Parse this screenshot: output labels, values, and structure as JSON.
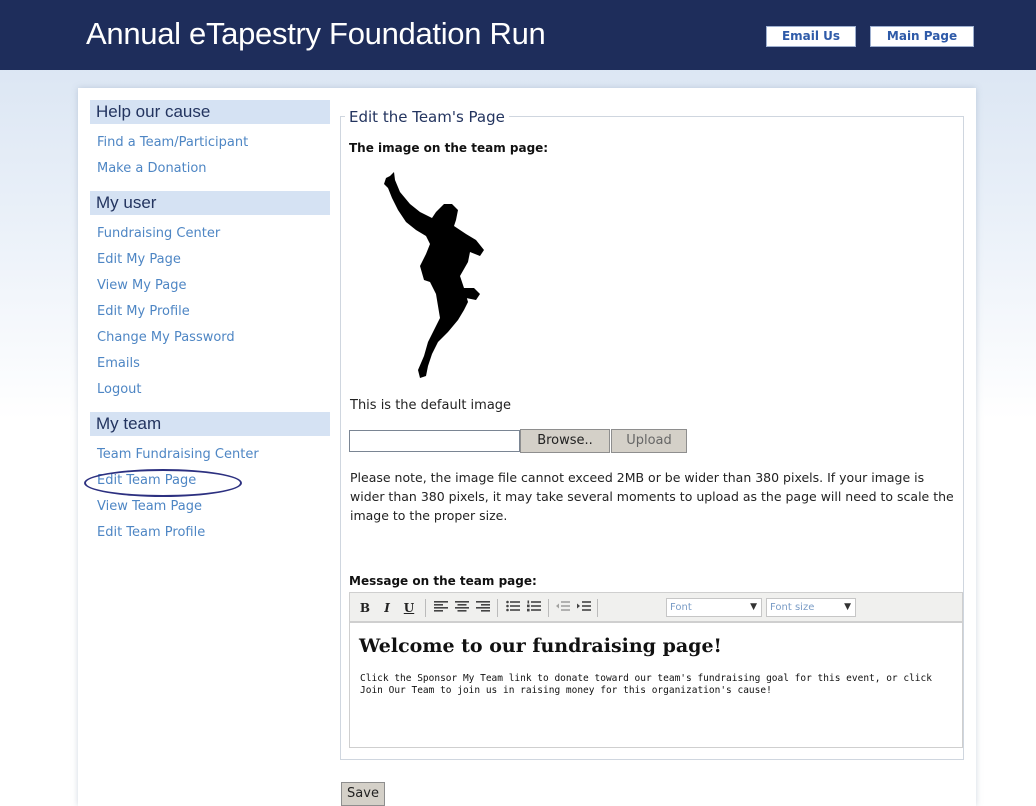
{
  "header": {
    "title": "Annual eTapestry Foundation Run",
    "email_us": "Email Us",
    "main_page": "Main Page"
  },
  "sidebar": {
    "sections": [
      {
        "heading": "Help our cause",
        "items": [
          "Find a Team/Participant",
          "Make a Donation"
        ]
      },
      {
        "heading": "My user",
        "items": [
          "Fundraising Center",
          "Edit My Page",
          "View My Page",
          "Edit My Profile",
          "Change My Password",
          "Emails",
          "Logout"
        ]
      },
      {
        "heading": "My team",
        "items": [
          "Team Fundraising Center",
          "Edit Team Page",
          "View Team Page",
          "Edit Team Profile"
        ]
      }
    ]
  },
  "content": {
    "legend": "Edit the Team's Page",
    "image_label": "The image on the team page:",
    "default_caption": "This is the default image",
    "file_value": "",
    "browse": "Browse..",
    "upload": "Upload",
    "note": "Please note, the image file cannot exceed 2MB or be wider than 380 pixels. If your image is wider than 380 pixels, it may take several moments to upload as the page will need to scale the image to the proper size.",
    "message_label": "Message on the team page:",
    "toolbar": {
      "bold": "B",
      "italic": "I",
      "underline": "U",
      "font": "Font",
      "font_size": "Font size"
    },
    "editor": {
      "heading": "Welcome to our fundraising page!",
      "body": "Click the Sponsor My Team link to donate toward our team's fundraising goal for this event, or click Join Our Team to join us in raising money for this organization's cause!"
    },
    "save": "Save"
  },
  "colors": {
    "header_bg": "#1e2d5b",
    "link": "#4e86c4",
    "sidebar_head_bg": "#d5e2f3",
    "circle_annotation": "#2c3080"
  }
}
